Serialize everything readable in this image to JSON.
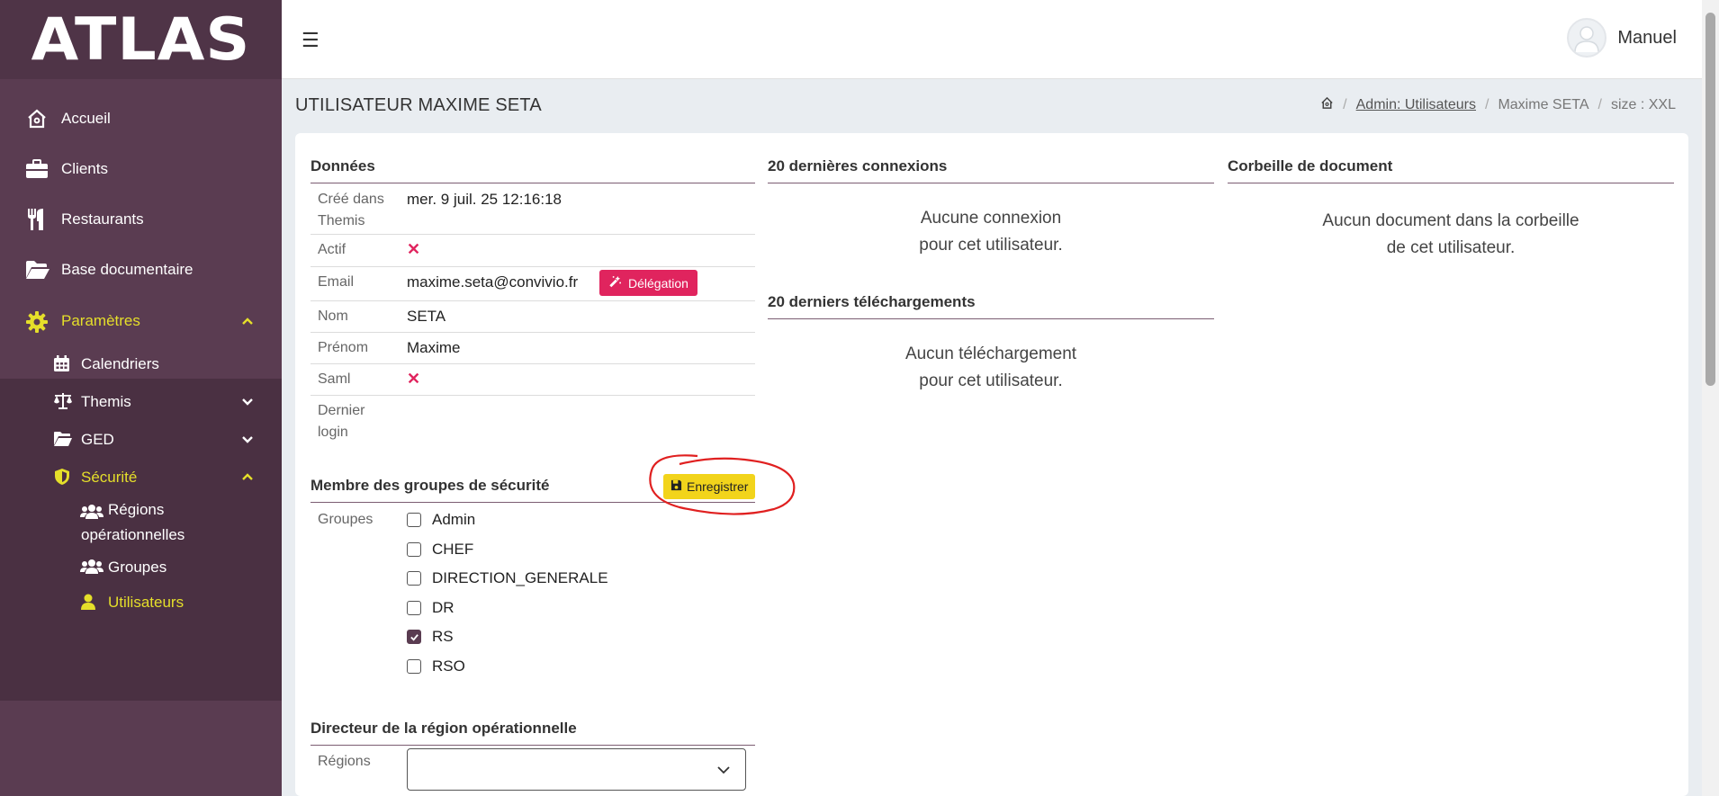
{
  "app": {
    "brand": "ATLAS",
    "user_name": "Manuel",
    "colors": {
      "sidebar": "#5a3c51",
      "active": "#e5df2a",
      "danger": "#e0245e",
      "save": "#f2d41b"
    }
  },
  "sidebar": {
    "items": [
      {
        "label": "Accueil",
        "icon": "home-icon"
      },
      {
        "label": "Clients",
        "icon": "briefcase-icon"
      },
      {
        "label": "Restaurants",
        "icon": "utensils-icon"
      },
      {
        "label": "Base documentaire",
        "icon": "folder-open-icon"
      },
      {
        "label": "Paramètres",
        "icon": "gear-icon"
      }
    ],
    "sub_items": [
      {
        "label": "Calendriers",
        "icon": "calendar-icon"
      },
      {
        "label": "Themis",
        "icon": "scale-icon"
      },
      {
        "label": "GED",
        "icon": "folder-icon"
      },
      {
        "label": "Sécurité",
        "icon": "shield-icon"
      }
    ],
    "security_items": [
      {
        "label_line1": "Régions",
        "label_line2": "opérationnelles",
        "icon": "users-icon"
      },
      {
        "label": "Groupes",
        "icon": "users-icon"
      },
      {
        "label": "Utilisateurs",
        "icon": "user-icon"
      }
    ]
  },
  "page": {
    "title": "UTILISATEUR MAXIME SETA",
    "breadcrumb": {
      "link": "Admin: Utilisateurs",
      "current": "Maxime SETA",
      "size": "size : XXL"
    }
  },
  "donnees": {
    "title": "Données",
    "cree_label_1": "Créé dans",
    "cree_label_2": "Themis",
    "cree_value": "mer. 9 juil. 25 12:16:18",
    "actif_label": "Actif",
    "email_label": "Email",
    "email_value": "maxime.seta@convivio.fr",
    "delegation_label": "Délégation",
    "nom_label": "Nom",
    "nom_value": "SETA",
    "prenom_label": "Prénom",
    "prenom_value": "Maxime",
    "saml_label": "Saml",
    "dernier_label_1": "Dernier",
    "dernier_label_2": "login",
    "x_glyph": "✕"
  },
  "groupes": {
    "title": "Membre des groupes de sécurité",
    "save_label": "Enregistrer",
    "label": "Groupes",
    "items": [
      {
        "name": "Admin",
        "checked": false
      },
      {
        "name": "CHEF",
        "checked": false
      },
      {
        "name": "DIRECTION_GENERALE",
        "checked": false
      },
      {
        "name": "DR",
        "checked": false
      },
      {
        "name": "RS",
        "checked": true
      },
      {
        "name": "RSO",
        "checked": false
      }
    ]
  },
  "directeur": {
    "title": "Directeur de la région opérationnelle",
    "label": "Régions",
    "value": ""
  },
  "connexions": {
    "title": "20 dernières connexions",
    "empty_1": "Aucune connexion",
    "empty_2": "pour cet utilisateur."
  },
  "telechargements": {
    "title": "20 derniers téléchargements",
    "empty_1": "Aucun téléchargement",
    "empty_2": "pour cet utilisateur."
  },
  "corbeille": {
    "title": "Corbeille de document",
    "empty_1": "Aucun document dans la corbeille",
    "empty_2": "de cet utilisateur."
  }
}
